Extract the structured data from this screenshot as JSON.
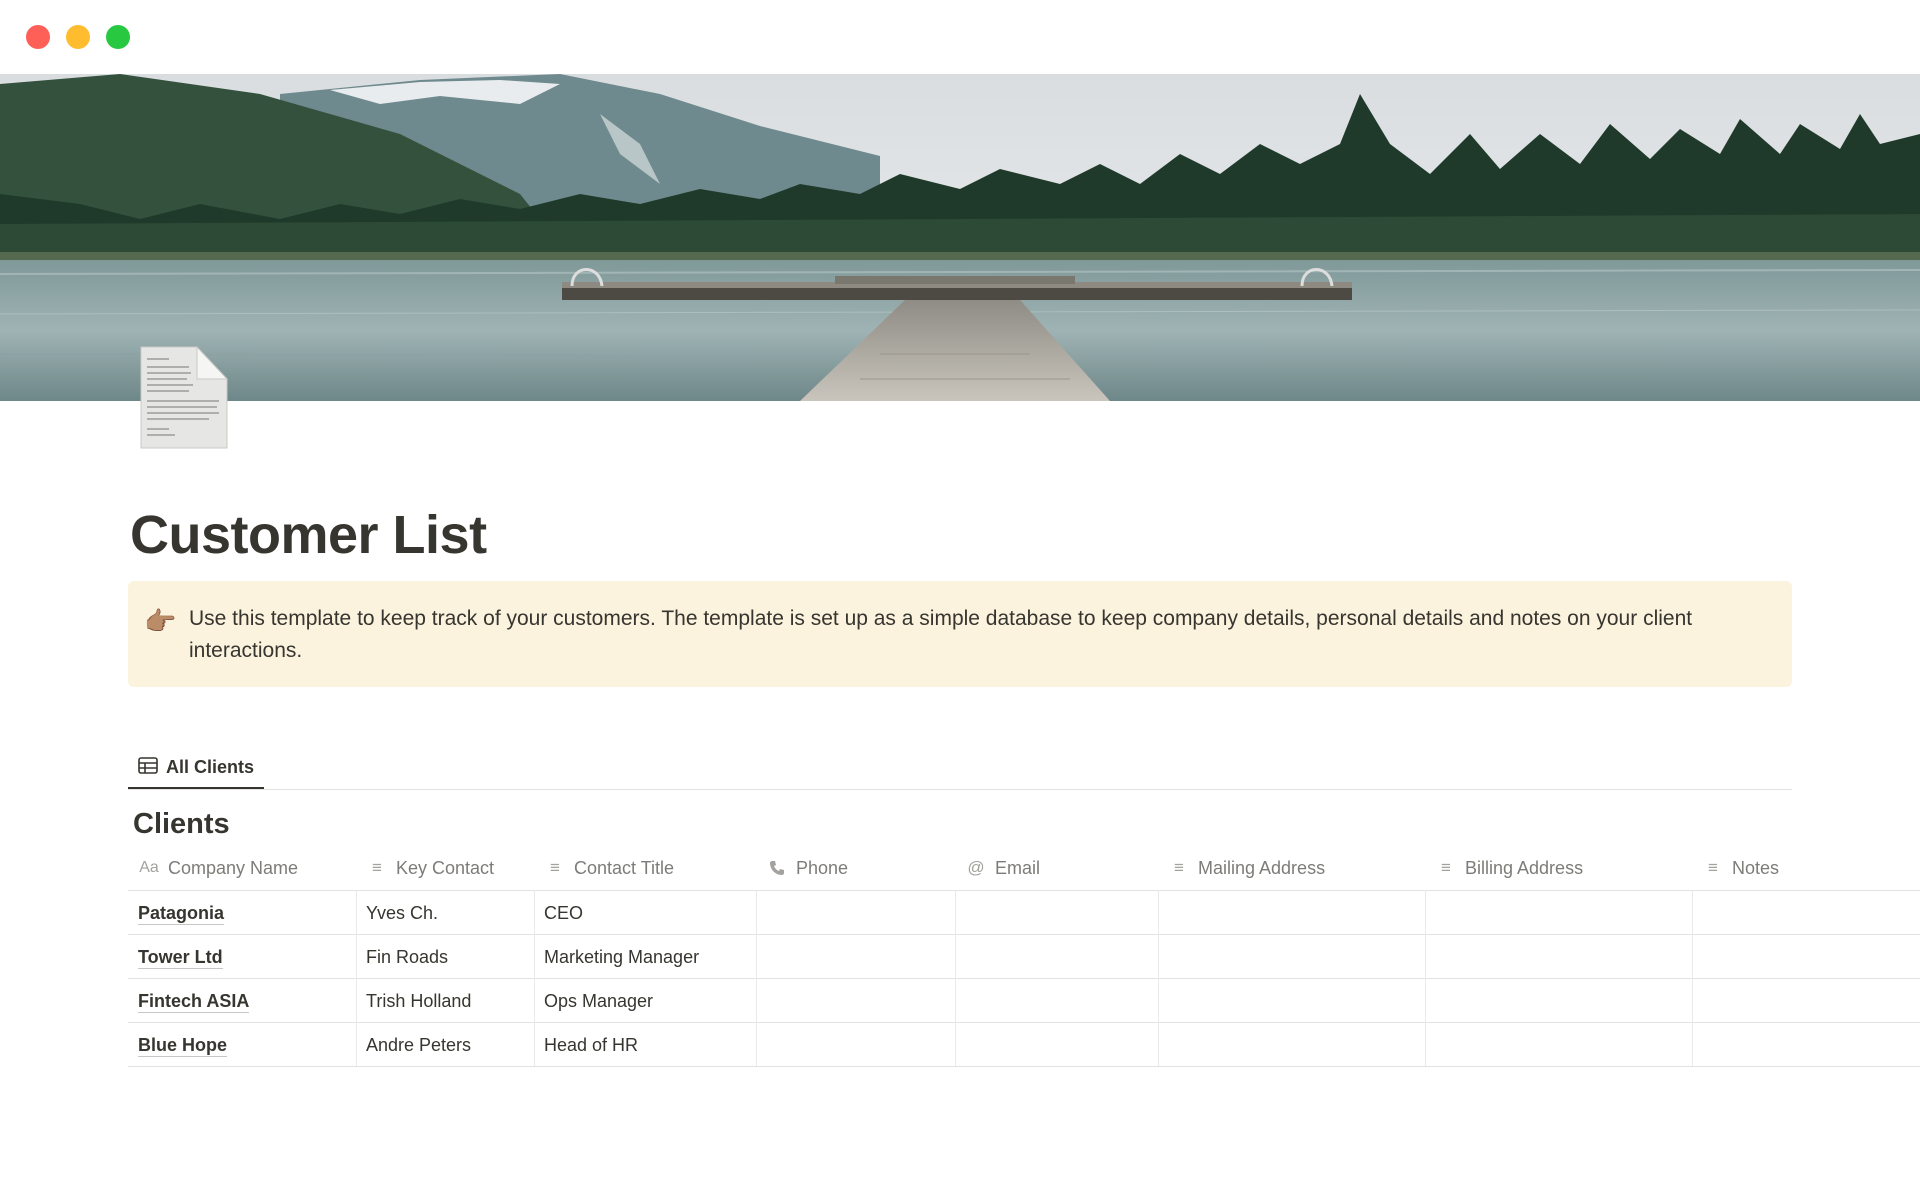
{
  "page": {
    "title": "Customer List",
    "icon": "document-icon",
    "cover": "lake-dock-mountains-photo"
  },
  "callout": {
    "icon": "pointing-hand-emoji",
    "emoji": "👉🏽",
    "text": "Use this template to keep track of your customers. The template is set up as a simple database to keep company details, personal details and notes on your client interactions.",
    "background": "#fbf3de"
  },
  "view_tabs": [
    {
      "label": "All Clients",
      "icon": "table-icon",
      "active": true
    }
  ],
  "database": {
    "title": "Clients",
    "columns": [
      {
        "label": "Company Name",
        "icon": "Aa"
      },
      {
        "label": "Key Contact",
        "icon": "text-lines-icon"
      },
      {
        "label": "Contact Title",
        "icon": "text-lines-icon"
      },
      {
        "label": "Phone",
        "icon": "phone-icon"
      },
      {
        "label": "Email",
        "icon": "at-sign-icon"
      },
      {
        "label": "Mailing Address",
        "icon": "text-lines-icon"
      },
      {
        "label": "Billing Address",
        "icon": "text-lines-icon"
      },
      {
        "label": "Notes",
        "icon": "text-lines-icon"
      }
    ],
    "rows": [
      {
        "company": "Patagonia",
        "contact": "Yves Ch.",
        "title": "CEO",
        "phone": "",
        "email": "",
        "mailing": "",
        "billing": "",
        "notes": ""
      },
      {
        "company": "Tower Ltd",
        "contact": "Fin Roads",
        "title": "Marketing Manager",
        "phone": "",
        "email": "",
        "mailing": "",
        "billing": "",
        "notes": ""
      },
      {
        "company": "Fintech ASIA",
        "contact": "Trish Holland",
        "title": "Ops Manager",
        "phone": "",
        "email": "",
        "mailing": "",
        "billing": "",
        "notes": ""
      },
      {
        "company": "Blue Hope",
        "contact": "Andre Peters",
        "title": "Head of HR",
        "phone": "",
        "email": "",
        "mailing": "",
        "billing": "",
        "notes": ""
      }
    ]
  }
}
